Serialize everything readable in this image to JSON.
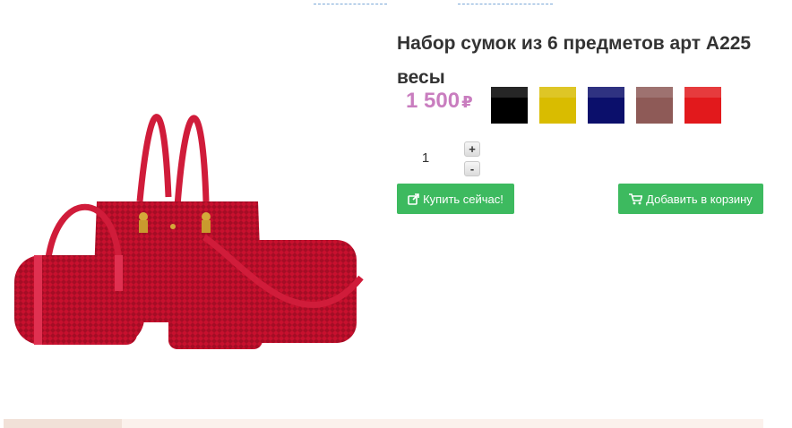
{
  "product": {
    "title_line1": "Набор сумок из 6 предметов арт A225",
    "title_line2": "весы",
    "price": "1 500",
    "currency": "₽",
    "colors": [
      "#000000",
      "#d9bc00",
      "#0b0f6b",
      "#8e5a57",
      "#e2191c"
    ],
    "quantity": "1",
    "qty_plus": "+",
    "qty_minus": "-"
  },
  "actions": {
    "buy_now": "Купить сейчас!",
    "add_to_cart": "Добавить в корзину"
  },
  "icons": {
    "buy": "external-link-icon",
    "cart": "shopping-cart-icon"
  },
  "accent": "#3dba5f"
}
